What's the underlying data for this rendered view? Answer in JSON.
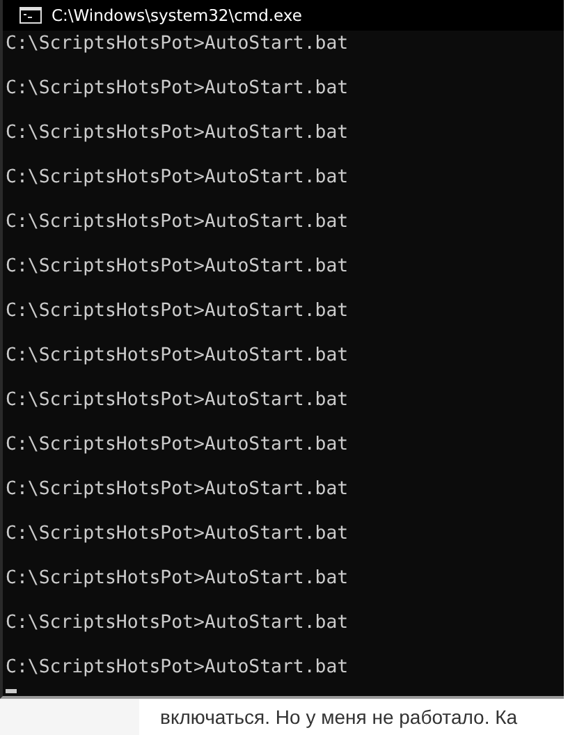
{
  "window": {
    "title": "C:\\Windows\\system32\\cmd.exe"
  },
  "console": {
    "lines": [
      "C:\\ScriptsHotsPot>AutoStart.bat",
      "C:\\ScriptsHotsPot>AutoStart.bat",
      "C:\\ScriptsHotsPot>AutoStart.bat",
      "C:\\ScriptsHotsPot>AutoStart.bat",
      "C:\\ScriptsHotsPot>AutoStart.bat",
      "C:\\ScriptsHotsPot>AutoStart.bat",
      "C:\\ScriptsHotsPot>AutoStart.bat",
      "C:\\ScriptsHotsPot>AutoStart.bat",
      "C:\\ScriptsHotsPot>AutoStart.bat",
      "C:\\ScriptsHotsPot>AutoStart.bat",
      "C:\\ScriptsHotsPot>AutoStart.bat",
      "C:\\ScriptsHotsPot>AutoStart.bat",
      "C:\\ScriptsHotsPot>AutoStart.bat",
      "C:\\ScriptsHotsPot>AutoStart.bat",
      "C:\\ScriptsHotsPot>AutoStart.bat"
    ]
  },
  "page": {
    "text": "включаться. Но у меня не работало. Ка"
  }
}
